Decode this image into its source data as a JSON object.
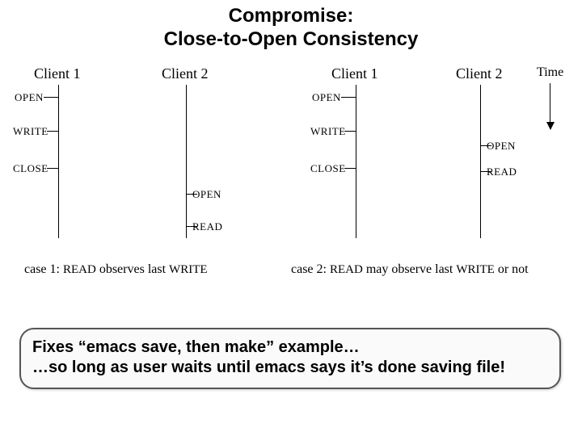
{
  "title": {
    "line1": "Compromise:",
    "line2": "Close-to-Open Consistency"
  },
  "time_label": "Time",
  "clients": {
    "c1": "Client 1",
    "c2": "Client 2"
  },
  "events": {
    "open": "OPEN",
    "write": "WRITE",
    "close": "CLOSE",
    "read": "READ"
  },
  "captions": {
    "case1_prefix": "case 1: ",
    "case1_a": "READ",
    "case1_mid": " observes last ",
    "case1_b": "WRITE",
    "case2_prefix": "case 2: ",
    "case2_a": "READ",
    "case2_mid": " may observe last ",
    "case2_b": "WRITE",
    "case2_suffix": " or not"
  },
  "callout": {
    "line1": "Fixes “emacs save, then make” example…",
    "line2": "…so long as user waits until emacs says it’s done saving file!"
  }
}
